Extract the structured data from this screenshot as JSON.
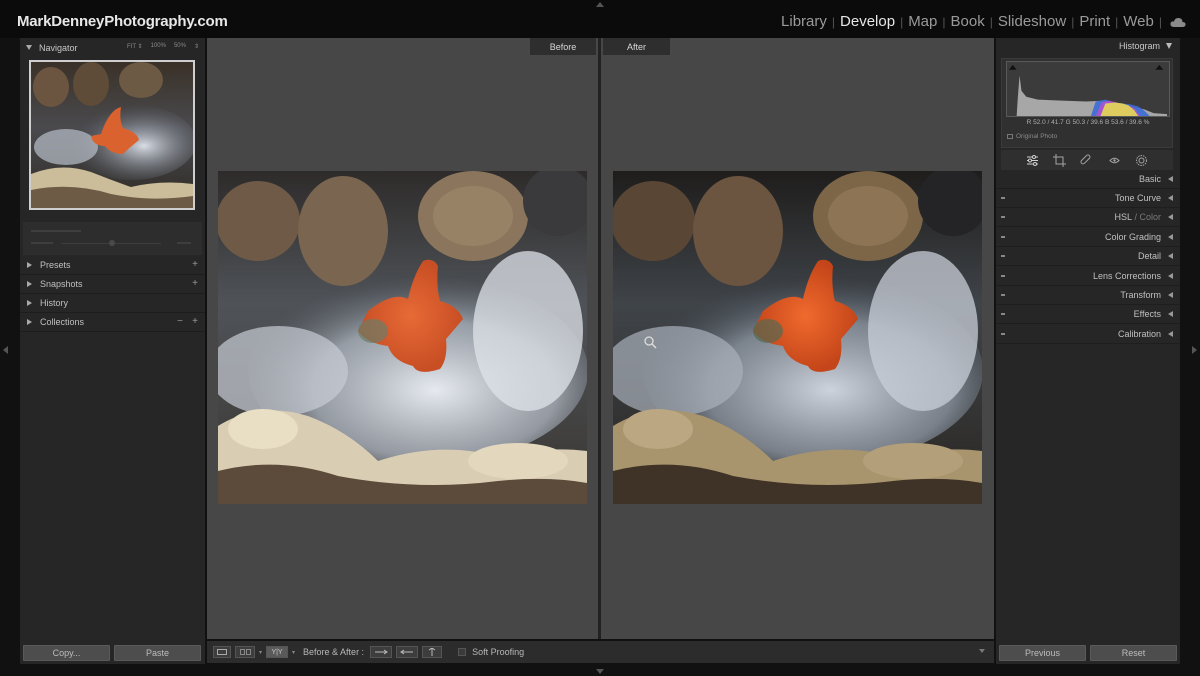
{
  "brand": "MarkDenneyPhotography.com",
  "modules": [
    {
      "label": "Library",
      "active": false
    },
    {
      "label": "Develop",
      "active": true
    },
    {
      "label": "Map",
      "active": false
    },
    {
      "label": "Book",
      "active": false
    },
    {
      "label": "Slideshow",
      "active": false
    },
    {
      "label": "Print",
      "active": false
    },
    {
      "label": "Web",
      "active": false
    }
  ],
  "left_panel": {
    "navigator": {
      "title": "Navigator",
      "zoom_options": [
        "FIT ⇕",
        "100%",
        "50%",
        "⇕"
      ]
    },
    "sections": [
      {
        "label": "Presets",
        "has_plus": true,
        "has_minus": false
      },
      {
        "label": "Snapshots",
        "has_plus": true,
        "has_minus": false
      },
      {
        "label": "History",
        "has_plus": false,
        "has_minus": false
      },
      {
        "label": "Collections",
        "has_plus": true,
        "has_minus": true
      }
    ],
    "copy_button": "Copy...",
    "paste_button": "Paste"
  },
  "center": {
    "before_label": "Before",
    "after_label": "After"
  },
  "toolbar": {
    "before_after_label": "Before & After :",
    "view_button": "Y|Y",
    "soft_proofing_label": "Soft Proofing"
  },
  "right_panel": {
    "histogram": {
      "title": "Histogram",
      "r_label": "R",
      "r_value": "52.0",
      "g_label": "G",
      "g_value": "50.3",
      "b_label": "B",
      "b_value": "53.6",
      "readout": "R  52.0 /  41.7   G  50.3 /  39.6   B  53.6 /  39.6  %",
      "original_photo": "Original Photo"
    },
    "sections": [
      {
        "label": "Basic"
      },
      {
        "label": "Tone Curve"
      },
      {
        "label": "HSL",
        "sub": "Color"
      },
      {
        "label": "Color Grading"
      },
      {
        "label": "Detail"
      },
      {
        "label": "Lens Corrections"
      },
      {
        "label": "Transform"
      },
      {
        "label": "Effects"
      },
      {
        "label": "Calibration"
      }
    ],
    "previous_button": "Previous",
    "reset_button": "Reset"
  }
}
